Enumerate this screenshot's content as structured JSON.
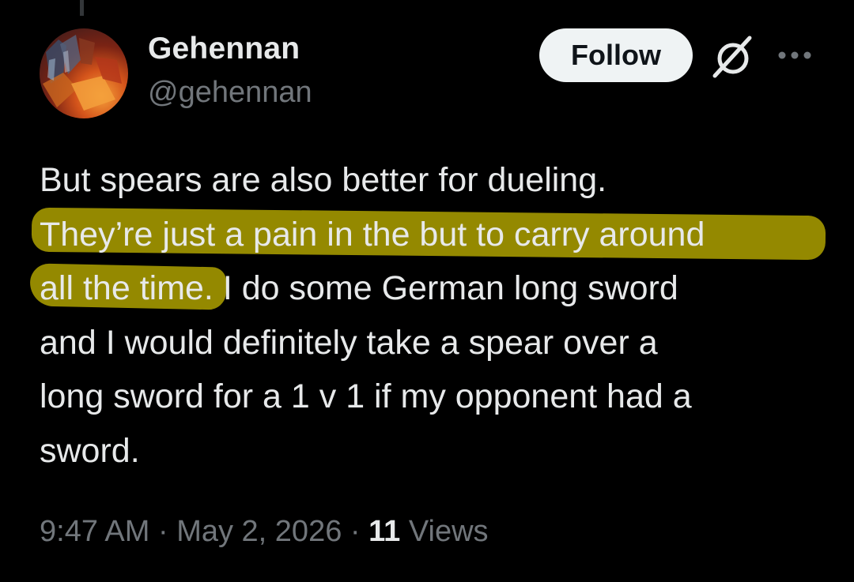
{
  "author": {
    "display_name": "Gehennan",
    "handle": "@gehennan"
  },
  "actions": {
    "follow_label": "Follow",
    "grok_icon": "grok-slash-circle-icon",
    "more_icon": "more-dots-icon"
  },
  "tweet": {
    "lines": [
      "But spears are also better for dueling.",
      "They’re just a pain in the but to carry around",
      "all the time. I do some German long sword",
      "and I would definitely take a spear over a",
      "long sword for a 1 v 1 if my opponent had a",
      "sword."
    ],
    "highlighted_text": "They’re just a pain in the but to carry around all the time",
    "highlight_color": "#beaf00"
  },
  "meta": {
    "time": "9:47 AM",
    "separator": "·",
    "date": "May 2, 2026",
    "views_count": "11",
    "views_label": "Views"
  },
  "colors": {
    "background": "#000000",
    "text_primary": "#e7e9ea",
    "text_secondary": "#71767b",
    "follow_bg": "#eff3f4"
  }
}
